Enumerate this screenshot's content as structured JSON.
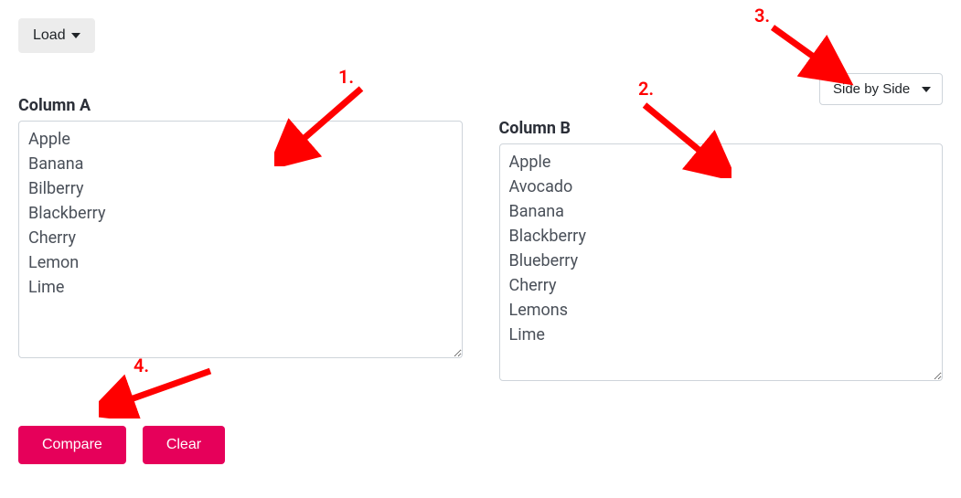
{
  "colors": {
    "accent": "#e6005a",
    "annotation": "#f00"
  },
  "load": {
    "label": "Load"
  },
  "viewSelect": {
    "selected": "Side by Side"
  },
  "columnA": {
    "label": "Column A",
    "text": "Apple\nBanana\nBilberry\nBlackberry\nCherry\nLemon\nLime"
  },
  "columnB": {
    "label": "Column B",
    "text": "Apple\nAvocado\nBanana\nBlackberry\nBlueberry\nCherry\nLemons\nLime"
  },
  "buttons": {
    "compare": "Compare",
    "clear": "Clear"
  },
  "annotations": {
    "one": "1.",
    "two": "2.",
    "three": "3.",
    "four": "4."
  }
}
